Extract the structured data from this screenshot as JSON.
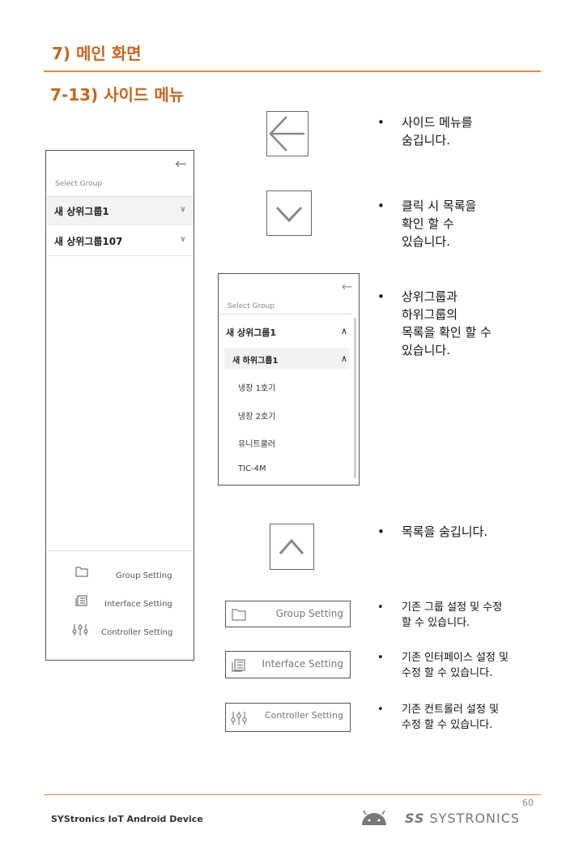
{
  "header": {
    "section_title": "7) 메인 화면",
    "subsection_title": "7-13) 사이드 메뉴"
  },
  "side_panel": {
    "back_icon": "arrow-left-icon",
    "select_label": "Select Group",
    "groups": [
      {
        "label": "새 상위그룹1"
      },
      {
        "label": "새 상위그룹107"
      }
    ],
    "footer": [
      {
        "label": "Group Setting",
        "icon": "folder-icon"
      },
      {
        "label": "Interface Setting",
        "icon": "list-icon"
      },
      {
        "label": "Controller Setting",
        "icon": "sliders-icon"
      }
    ]
  },
  "expanded_panel": {
    "select_label": "Select Group",
    "parent_group": "새 상위그룹1",
    "child_group": "새 하위그룹1",
    "items": [
      "냉장 1호기",
      "냉장 2호기",
      "유니트쿨러",
      "TIC-4M"
    ]
  },
  "buttons": {
    "group_setting": "Group Setting",
    "interface_setting": "Interface Setting",
    "controller_setting": "Controller Setting"
  },
  "descriptions": {
    "back": "사이드 메뉴를\n숨깁니다.",
    "expand": "클릭 시 목록을\n확인 할 수\n있습니다.",
    "tree": "상위그룹과\n하위그룹의\n목록을 확인 할 수\n있습니다.",
    "collapse": "목록을 숨깁니다.",
    "group_setting": "기존 그룹 설정 및 수정\n할 수 있습니다.",
    "interface_setting": "기존 인터페이스 설정 및\n수정 할 수 있습니다.",
    "controller_setting": "기존 컨트롤러 설정 및\n수정 할 수 있습니다."
  },
  "footer": {
    "page_number": "60",
    "doc_title": "SYStronics IoT Android Device",
    "logo_text": "SYSTRONICS"
  },
  "colors": {
    "accent": "#c8661b",
    "rule": "#e48a3e"
  }
}
